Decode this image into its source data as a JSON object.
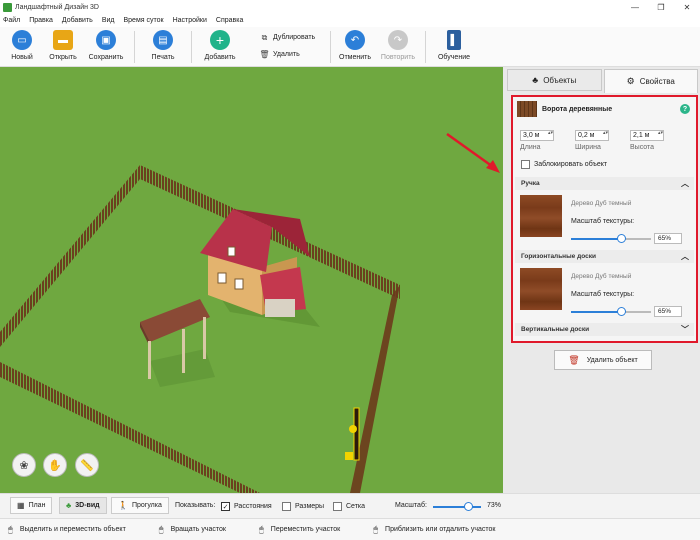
{
  "window": {
    "title": "Ландшафтный Дизайн 3D"
  },
  "menu": [
    "Файл",
    "Правка",
    "Добавить",
    "Вид",
    "Время суток",
    "Настройки",
    "Справка"
  ],
  "toolbar": {
    "new": "Новый",
    "open": "Открыть",
    "save": "Сохранить",
    "print": "Печать",
    "add": "Добавить",
    "duplicate": "Дублировать",
    "delete": "Удалить",
    "undo": "Отменить",
    "redo": "Повторить",
    "learn": "Обучение"
  },
  "panel": {
    "tabs": {
      "objects": "Объекты",
      "properties": "Свойства"
    },
    "object_name": "Ворота деревянные",
    "help": "?",
    "dims": [
      {
        "value": "3,0 м",
        "caption": "Длина"
      },
      {
        "value": "0,2 м",
        "caption": "Ширина"
      },
      {
        "value": "2,1 м",
        "caption": "Высота"
      }
    ],
    "lock_label": "Заблокировать объект",
    "sections": [
      {
        "title": "Ручка",
        "texture": "Дерево Дуб темный",
        "scale_label": "Масштаб текстуры:",
        "scale": "65%",
        "scale_value": 0.65
      },
      {
        "title": "Горизонтальные доски",
        "texture": "Дерево Дуб темный",
        "scale_label": "Масштаб текстуры:",
        "scale": "65%",
        "scale_value": 0.65
      },
      {
        "title": "Вертикальные доски"
      }
    ],
    "delete_object": "Удалить объект"
  },
  "bottom": {
    "plan": "План",
    "view3d": "3D-вид",
    "walk": "Прогулка",
    "show_label": "Показывать:",
    "distances": "Расстояния",
    "sizes": "Размеры",
    "grid": "Сетка",
    "scale_label": "Масштаб:",
    "zoom": "73%",
    "zoom_value": 0.73
  },
  "status": [
    "Выделить и переместить объект",
    "Вращать участок",
    "Переместить участок",
    "Приблизить или отдалить участок"
  ],
  "colors": {
    "highlight": "#e0192b",
    "grass": "#6fa840",
    "accent": "#2c7fd8"
  }
}
